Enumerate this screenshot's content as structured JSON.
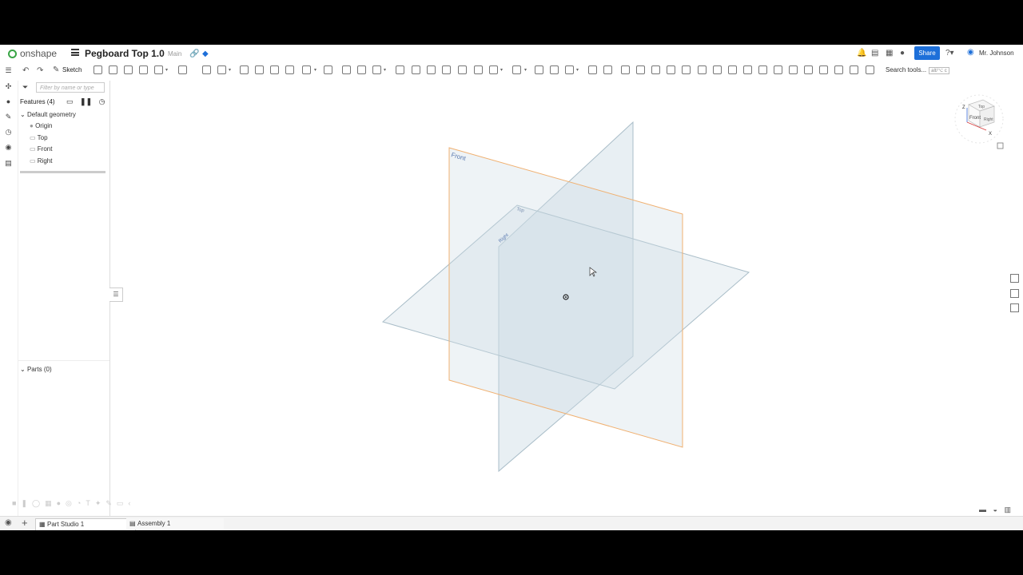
{
  "header": {
    "logo_text": "onshape",
    "doc_title": "Pegboard Top 1.0",
    "branch": "Main",
    "share_label": "Share",
    "notification_count": "1",
    "user_name": "Mr. Johnson"
  },
  "toolbar": {
    "sketch_label": "Sketch",
    "search_tools_label": "Search tools...",
    "search_shortcut": "alt/⌥ c"
  },
  "feature_panel": {
    "filter_placeholder": "Filter by name or type",
    "features_label": "Features (4)",
    "default_geometry_label": "Default geometry",
    "items": [
      "Origin",
      "Top",
      "Front",
      "Right"
    ],
    "parts_label": "Parts (0)"
  },
  "viewport": {
    "plane_labels": {
      "front": "Front",
      "top": "Top",
      "right": "Right"
    }
  },
  "viewcube": {
    "top": "Top",
    "front": "Front",
    "right": "Right",
    "axis_z": "Z",
    "axis_x": "X"
  },
  "tabs": [
    {
      "label": "Part Studio 1",
      "active": true
    },
    {
      "label": "Assembly 1",
      "active": false
    }
  ],
  "colors": {
    "accent": "#1d6fd9",
    "front_plane_edge": "#f0b070",
    "plane_fill": "#dce6ec",
    "plane_edge": "#9fb5c3"
  }
}
